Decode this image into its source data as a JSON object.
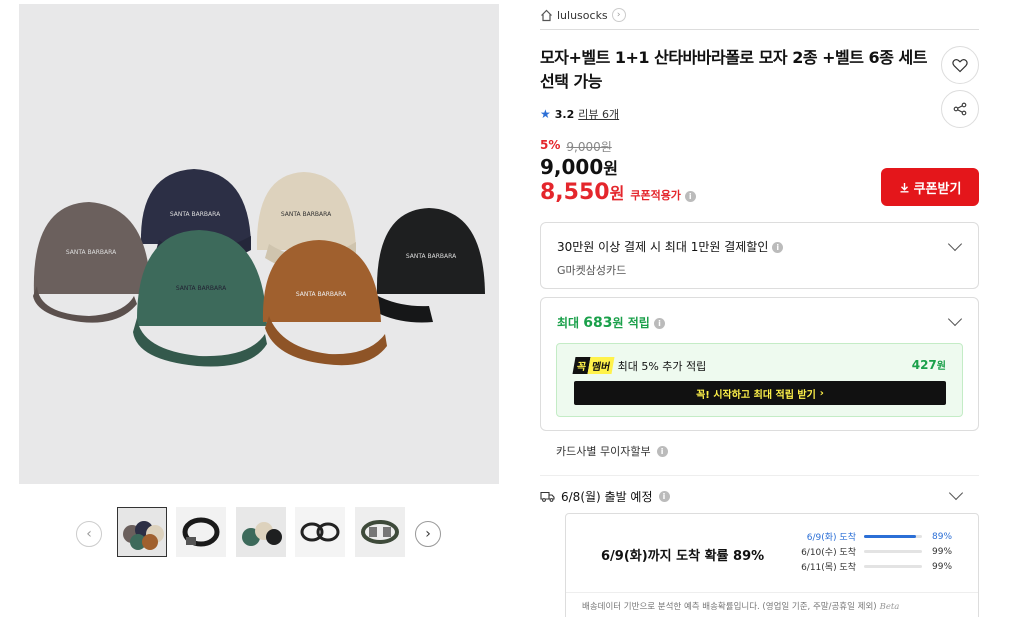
{
  "seller": {
    "name": "lulusocks",
    "home_icon": "home-icon",
    "arrow": "›"
  },
  "product": {
    "title": "모자+벨트 1+1 산타바바라폴로 모자 2종 +벨트 6종 세트 선택 가능",
    "rating": "3.2",
    "reviews": "리뷰 6개",
    "discount_rate": "5%",
    "original_price": "9,000원",
    "price_number": "9,000",
    "price_unit": "원",
    "coupon_price_number": "8,550",
    "coupon_price_unit": "원",
    "coupon_note": "쿠폰적용가"
  },
  "buttons": {
    "coupon": "쿠폰받기",
    "coupon_icon": "download-icon",
    "wishlist_icon": "heart-icon",
    "share_icon": "share-icon"
  },
  "gallery": {
    "prev": "‹",
    "next": "›",
    "thumbnails": [
      "caps",
      "belt-black",
      "caps-2",
      "belts-set",
      "belts-mixed"
    ]
  },
  "card_promo": {
    "line1": "30만원 이상 결제 시 최대 1만원 결제할인",
    "line2": "G마켓삼성카드"
  },
  "points": {
    "prefix": "최대 ",
    "amount": "683",
    "suffix": "원 적립",
    "badge_a": "꼭",
    "badge_b": "멤버",
    "member_text": "최대 5% 추가 적립",
    "member_points": "427",
    "member_points_unit": "원",
    "join_label": "꼭! 시작하고 최대 적립 받기",
    "join_arrow": "›"
  },
  "installment": "카드사별 무이자할부",
  "shipping": {
    "departure": "6/8(월) 출발 예정",
    "truck_icon": "truck-icon",
    "probability": "6/9(화)까지 도착 확률 89%",
    "rows": [
      {
        "date": "6/9(화) 도착",
        "percent": "89%",
        "fill": 0.89
      },
      {
        "date": "6/10(수) 도착",
        "percent": "99%",
        "fill": 0.0
      },
      {
        "date": "6/11(목) 도착",
        "percent": "99%",
        "fill": 0.0
      }
    ],
    "note": "배송데이터 기반으로 분석한 예측 배송확률입니다. (영업일 기준, 주말/공휴일 제외)",
    "beta": "Beta"
  },
  "colors": {
    "accent_red": "#e4262c",
    "green": "#1aa04a",
    "blue": "#2b6fd6",
    "yellow": "#fff24a"
  }
}
